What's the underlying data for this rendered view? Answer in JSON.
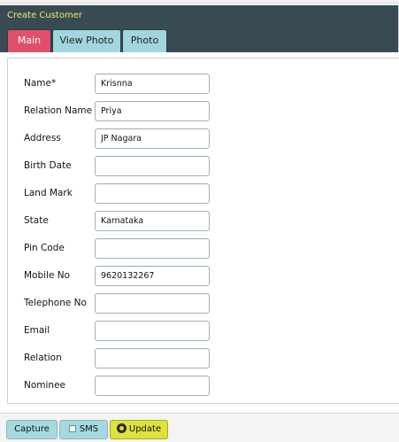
{
  "title": "Create Customer",
  "tabs": {
    "main": "Main",
    "view_photo": "View Photo",
    "photo": "Photo"
  },
  "form": {
    "name": {
      "label": "Name*",
      "value": "Krisnna"
    },
    "relation_name": {
      "label": "Relation Name",
      "value": "Priya"
    },
    "address": {
      "label": "Address",
      "value": "JP Nagara"
    },
    "birth_date": {
      "label": "Birth Date",
      "value": ""
    },
    "land_mark": {
      "label": "Land Mark",
      "value": ""
    },
    "state": {
      "label": "State",
      "value": "Karnataka"
    },
    "pin_code": {
      "label": "Pin Code",
      "value": ""
    },
    "mobile_no": {
      "label": "Mobile No",
      "value": "9620132267"
    },
    "telephone_no": {
      "label": "Telephone No",
      "value": ""
    },
    "email": {
      "label": "Email",
      "value": ""
    },
    "relation": {
      "label": "Relation",
      "value": ""
    },
    "nominee": {
      "label": "Nominee",
      "value": ""
    }
  },
  "buttons": {
    "capture": "Capture",
    "sms": "SMS",
    "update": "Update"
  },
  "icons": {
    "sms": "sms-icon",
    "update": "update-icon"
  },
  "colors": {
    "titlebar_bg": "#384b52",
    "title_text": "#f3e96a",
    "active_tab": "#e0506a",
    "inactive_tab": "#a2d6de",
    "update_button": "#dde23c"
  }
}
